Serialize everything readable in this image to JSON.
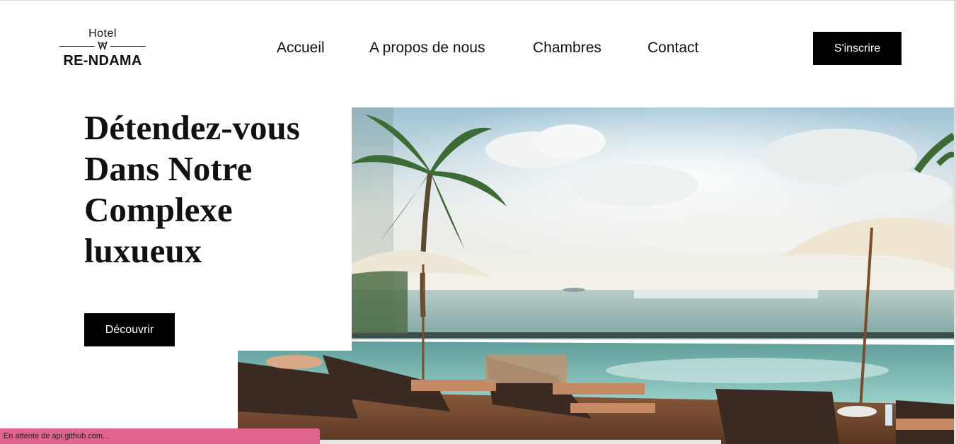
{
  "logo": {
    "small_text": "Hotel",
    "big_text": "RE-NDAMA"
  },
  "nav": {
    "items": [
      {
        "label": "Accueil"
      },
      {
        "label": "A propos de nous"
      },
      {
        "label": "Chambres"
      },
      {
        "label": "Contact"
      }
    ],
    "signup_label": "S'inscrire"
  },
  "hero": {
    "title_lines": [
      "Détendez-vous",
      "Dans Notre",
      "Complexe",
      "luxueux"
    ],
    "button_label": "Découvrir"
  },
  "status": {
    "text": "En attente de api.github.com..."
  },
  "colors": {
    "button_bg": "#000000",
    "status_bg": "#e0648e"
  }
}
